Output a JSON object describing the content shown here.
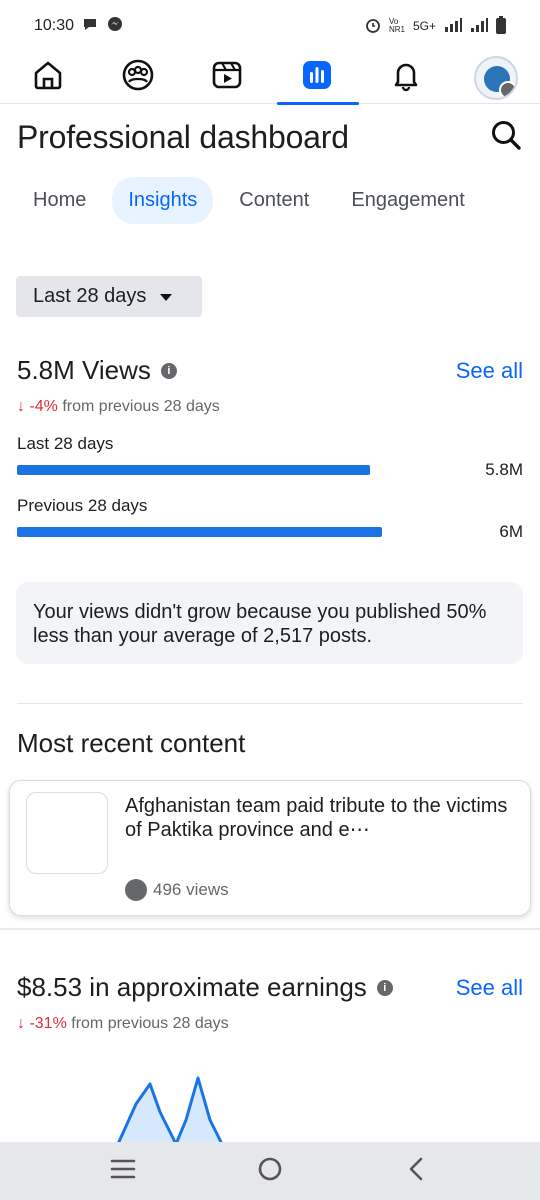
{
  "status_bar": {
    "time": "10:30",
    "network": "5G+",
    "volte": "Vo NR1"
  },
  "nav": {
    "items": [
      {
        "name": "home-icon"
      },
      {
        "name": "groups-icon"
      },
      {
        "name": "reels-icon"
      },
      {
        "name": "dashboard-icon"
      },
      {
        "name": "notifications-icon"
      },
      {
        "name": "profile-avatar"
      }
    ],
    "active_index": 3,
    "accent": "#0866ff"
  },
  "header": {
    "title": "Professional dashboard"
  },
  "tabs": [
    {
      "label": "Home",
      "active": false
    },
    {
      "label": "Insights",
      "active": true
    },
    {
      "label": "Content",
      "active": false
    },
    {
      "label": "Engagement",
      "active": false
    }
  ],
  "range": {
    "label": "Last 28 days"
  },
  "views": {
    "title": "5.8M Views",
    "see_all": "See all",
    "delta_arrow": "↓",
    "delta_value": "-4%",
    "delta_text": " from previous 28 days",
    "bars": [
      {
        "label": "Last 28 days",
        "value_text": "5.8M",
        "value": 5.8
      },
      {
        "label": "Previous 28 days",
        "value_text": "6M",
        "value": 6.0
      }
    ],
    "insight": "Your views didn't grow because you published 50% less than your average of 2,517 posts."
  },
  "recent": {
    "title": "Most recent content",
    "item": {
      "title": "Afghanistan team paid tribute to the victims of Paktika province and e⋯",
      "views": "496 views"
    }
  },
  "earnings": {
    "title": "$8.53 in approximate earnings",
    "see_all": "See all",
    "delta_arrow": "↓",
    "delta_value": "-31%",
    "delta_text": " from previous 28 days"
  },
  "colors": {
    "accent": "#0866ff",
    "bar": "#1b74e4",
    "negative": "#e02e3a",
    "card_bg": "#f2f4f7"
  }
}
